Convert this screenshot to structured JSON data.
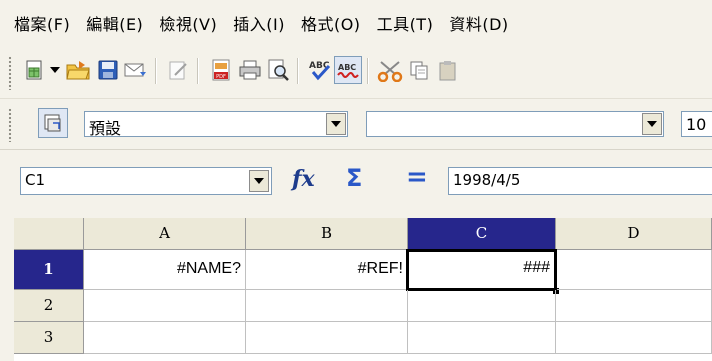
{
  "menu": [
    "檔案(F)",
    "編輯(E)",
    "檢視(V)",
    "插入(I)",
    "格式(O)",
    "工具(T)",
    "資料(D)"
  ],
  "toolbar_icons": [
    "new-document-icon",
    "dropdown-arrow-icon",
    "open-folder-icon",
    "save-icon",
    "email-icon",
    "edit-file-icon",
    "export-pdf-icon",
    "print-icon",
    "print-preview-icon",
    "spellcheck-icon",
    "autospellcheck-icon",
    "cut-icon",
    "copy-icon",
    "paste-icon"
  ],
  "format_toolbar": {
    "style_value": "預設",
    "font_name_value": "",
    "font_size_value": "10"
  },
  "formula_bar": {
    "name_box_value": "C1",
    "function_wizard_label": "fx",
    "sum_label": "Σ",
    "equals_label": "=",
    "input_value": "1998/4/5"
  },
  "sheet": {
    "columns": [
      "A",
      "B",
      "C",
      "D"
    ],
    "rows": [
      "1",
      "2",
      "3"
    ],
    "selected_column": "C",
    "selected_row": "1",
    "cells": {
      "A1": "#NAME?",
      "B1": "#REF!",
      "C1": "###",
      "D1": ""
    }
  },
  "colors": {
    "selected_header": "#26268c",
    "chrome_background": "#f4f2ea"
  }
}
